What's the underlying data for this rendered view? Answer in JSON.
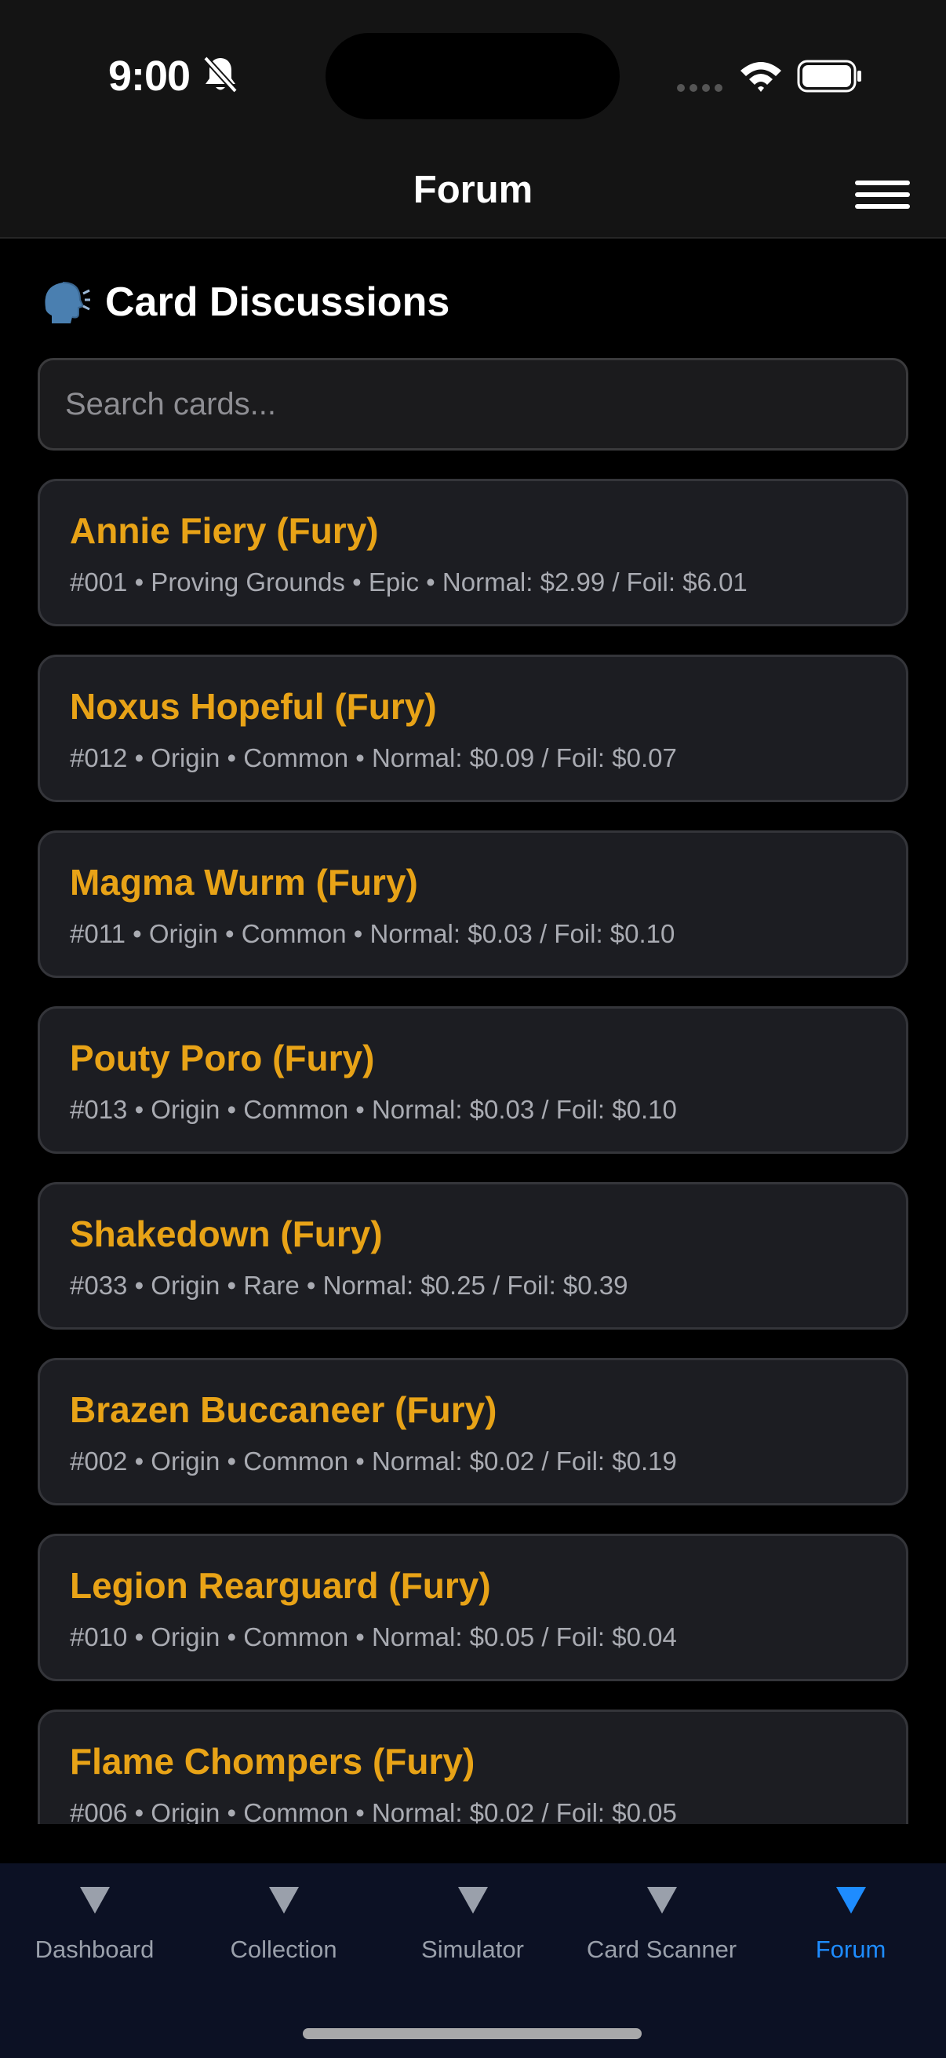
{
  "status_bar": {
    "time": "9:00"
  },
  "header": {
    "title": "Forum"
  },
  "section": {
    "icon": "speaking-head-icon",
    "title": "Card Discussions"
  },
  "search": {
    "placeholder": "Search cards...",
    "value": ""
  },
  "cards": [
    {
      "name": "Annie Fiery (Fury)",
      "meta": "#001 • Proving Grounds • Epic • Normal: $2.99 / Foil: $6.01"
    },
    {
      "name": "Noxus Hopeful (Fury)",
      "meta": "#012 • Origin • Common • Normal: $0.09 / Foil: $0.07"
    },
    {
      "name": "Magma Wurm (Fury)",
      "meta": "#011 • Origin • Common • Normal: $0.03 / Foil: $0.10"
    },
    {
      "name": "Pouty Poro (Fury)",
      "meta": "#013 • Origin • Common • Normal: $0.03 / Foil: $0.10"
    },
    {
      "name": "Shakedown (Fury)",
      "meta": "#033 • Origin • Rare • Normal: $0.25 / Foil: $0.39"
    },
    {
      "name": "Brazen Buccaneer (Fury)",
      "meta": "#002 • Origin • Common • Normal: $0.02 / Foil: $0.19"
    },
    {
      "name": "Legion Rearguard (Fury)",
      "meta": "#010 • Origin • Common • Normal: $0.05 / Foil: $0.04"
    },
    {
      "name": "Flame Chompers (Fury)",
      "meta": "#006 • Origin • Common • Normal: $0.02 / Foil: $0.05"
    }
  ],
  "tabs": [
    {
      "label": "Dashboard",
      "icon": "triangle-down-icon",
      "active": false
    },
    {
      "label": "Collection",
      "icon": "triangle-down-icon",
      "active": false
    },
    {
      "label": "Simulator",
      "icon": "triangle-down-icon",
      "active": false
    },
    {
      "label": "Card Scanner",
      "icon": "triangle-down-icon",
      "active": false
    },
    {
      "label": "Forum",
      "icon": "triangle-down-icon",
      "active": true
    }
  ],
  "colors": {
    "accent": "#1e8cff",
    "card_title": "#e8a317",
    "inactive_tab": "#9aa0ab",
    "tab_bar_bg": "#0c1124"
  }
}
